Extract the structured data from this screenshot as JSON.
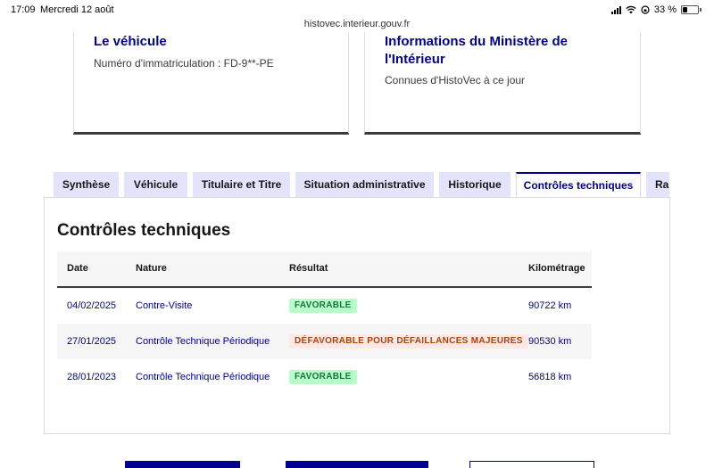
{
  "status_bar": {
    "time": "17:09",
    "date": "Mercredi 12 août",
    "battery": "33 %",
    "battery_level": 0.33
  },
  "browser": {
    "url": "histovec.interieur.gouv.fr"
  },
  "cards": {
    "vehicle": {
      "title": "Le véhicule",
      "text": "Numéro d'immatriculation : FD-9**-PE"
    },
    "ministry": {
      "title": "Informations du Ministère de l'Intérieur",
      "text": "Connues d'HistoVec à ce jour"
    }
  },
  "tabs": [
    {
      "label": "Synthèse",
      "active": false
    },
    {
      "label": "Véhicule",
      "active": false
    },
    {
      "label": "Titulaire et Titre",
      "active": false
    },
    {
      "label": "Situation administrative",
      "active": false
    },
    {
      "label": "Historique",
      "active": false
    },
    {
      "label": "Contrôles techniques",
      "active": true
    },
    {
      "label": "Rapport",
      "active": false
    }
  ],
  "panel": {
    "title": "Contrôles techniques",
    "columns": [
      "Date",
      "Nature",
      "Résultat",
      "Kilométrage"
    ],
    "rows": [
      {
        "date": "04/02/2025",
        "nature": "Contre-Visite",
        "result": "FAVORABLE",
        "result_type": "favorable",
        "km": "90722 km"
      },
      {
        "date": "27/01/2025",
        "nature": "Contrôle Technique Périodique",
        "result": "DÉFAVORABLE POUR DÉFAILLANCES MAJEURES",
        "result_type": "defavorable",
        "km": "90530 km"
      },
      {
        "date": "28/01/2023",
        "nature": "Contrôle Technique Périodique",
        "result": "FAVORABLE",
        "result_type": "favorable",
        "km": "56818 km"
      }
    ]
  },
  "colors": {
    "primary": "#000091",
    "favorable_bg": "#b8fec9",
    "favorable_text": "#18753c",
    "defavorable_bg": "#ffe9e6",
    "defavorable_text": "#b34000"
  }
}
